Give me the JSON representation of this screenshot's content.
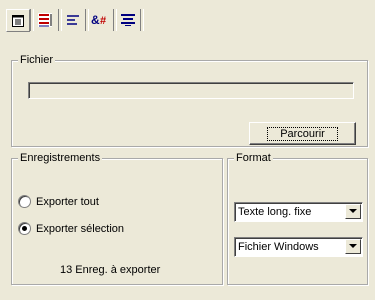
{
  "toolbar": {
    "icons": [
      "page-icon",
      "fields-icon",
      "align-icon",
      "character-map-icon",
      "list-icon"
    ],
    "active_index": 0
  },
  "fichier": {
    "title": "Fichier",
    "path_value": "",
    "browse_label": "Parcourir"
  },
  "enregistrements": {
    "title": "Enregistrements",
    "options": [
      "Exporter tout",
      "Exporter sélection"
    ],
    "selected": "Exporter sélection",
    "count_text": "13 Enreg. à exporter"
  },
  "format": {
    "title": "Format",
    "type_value": "Texte long. fixe",
    "encoding_value": "Fichier Windows"
  }
}
